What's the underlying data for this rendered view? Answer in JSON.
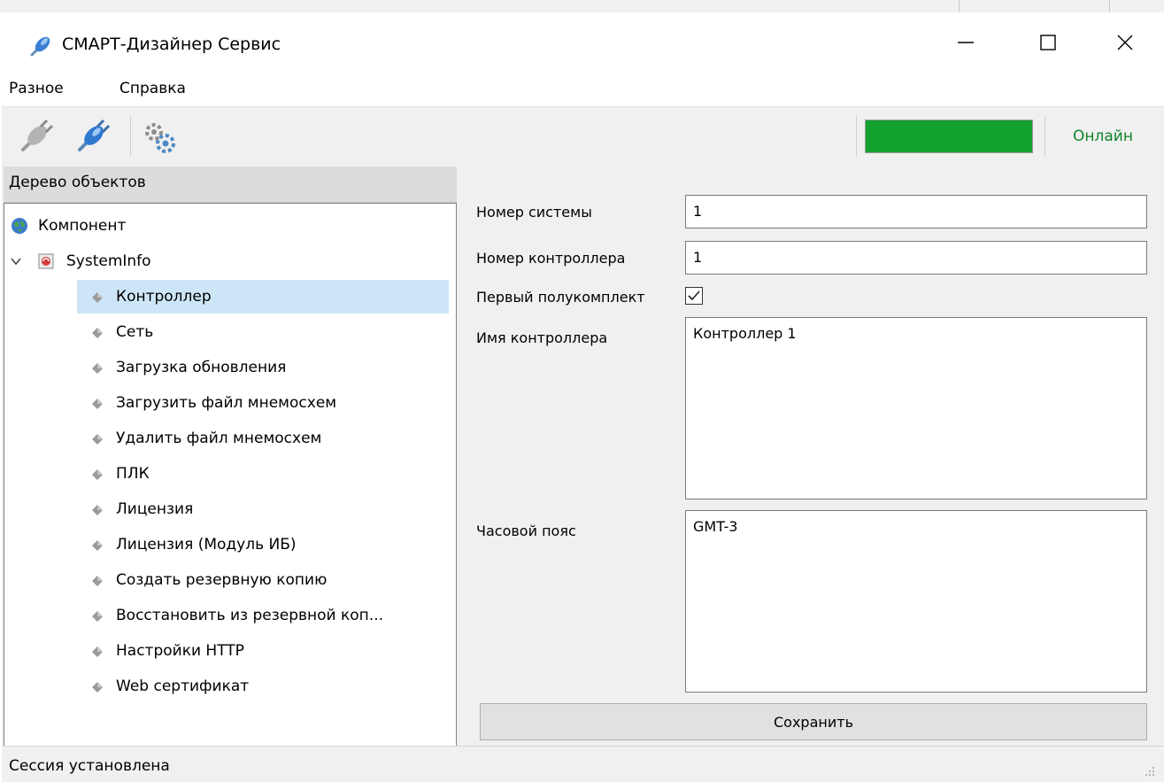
{
  "window": {
    "title": "СМАРТ-Дизайнер Сервис"
  },
  "menu": {
    "items": [
      "Разное",
      "Справка"
    ]
  },
  "toolbar": {
    "icons": [
      "plug-disconnected-icon",
      "plug-connected-icon",
      "gears-icon"
    ],
    "connection_status": "Онлайн",
    "status_color": "#12a12e"
  },
  "tree": {
    "header": "Дерево объектов",
    "root": "Компонент",
    "group": "SystemInfo",
    "items": [
      "Контроллер",
      "Сеть",
      "Загрузка обновления",
      "Загрузить файл мнемосхем",
      "Удалить файл мнемосхем",
      "ПЛК",
      "Лицензия",
      "Лицензия (Модуль ИБ)",
      "Создать резервную копию",
      "Восстановить из резервной коп...",
      "Настройки HTTP",
      "Web сертификат"
    ],
    "selected": "Контроллер"
  },
  "form": {
    "system_number_label": "Номер системы",
    "system_number_value": "1",
    "controller_number_label": "Номер контроллера",
    "controller_number_value": "1",
    "first_half_label": "Первый полукомплект",
    "first_half_checked": true,
    "controller_name_label": "Имя контроллера",
    "controller_name_value": "Контроллер 1",
    "timezone_label": "Часовой пояс",
    "timezone_value": "GMT-3",
    "save_label": "Сохранить"
  },
  "status": {
    "text": "Сессия установлена"
  },
  "colors": {
    "selection": "#cde6f7",
    "online_text": "#11842a"
  }
}
